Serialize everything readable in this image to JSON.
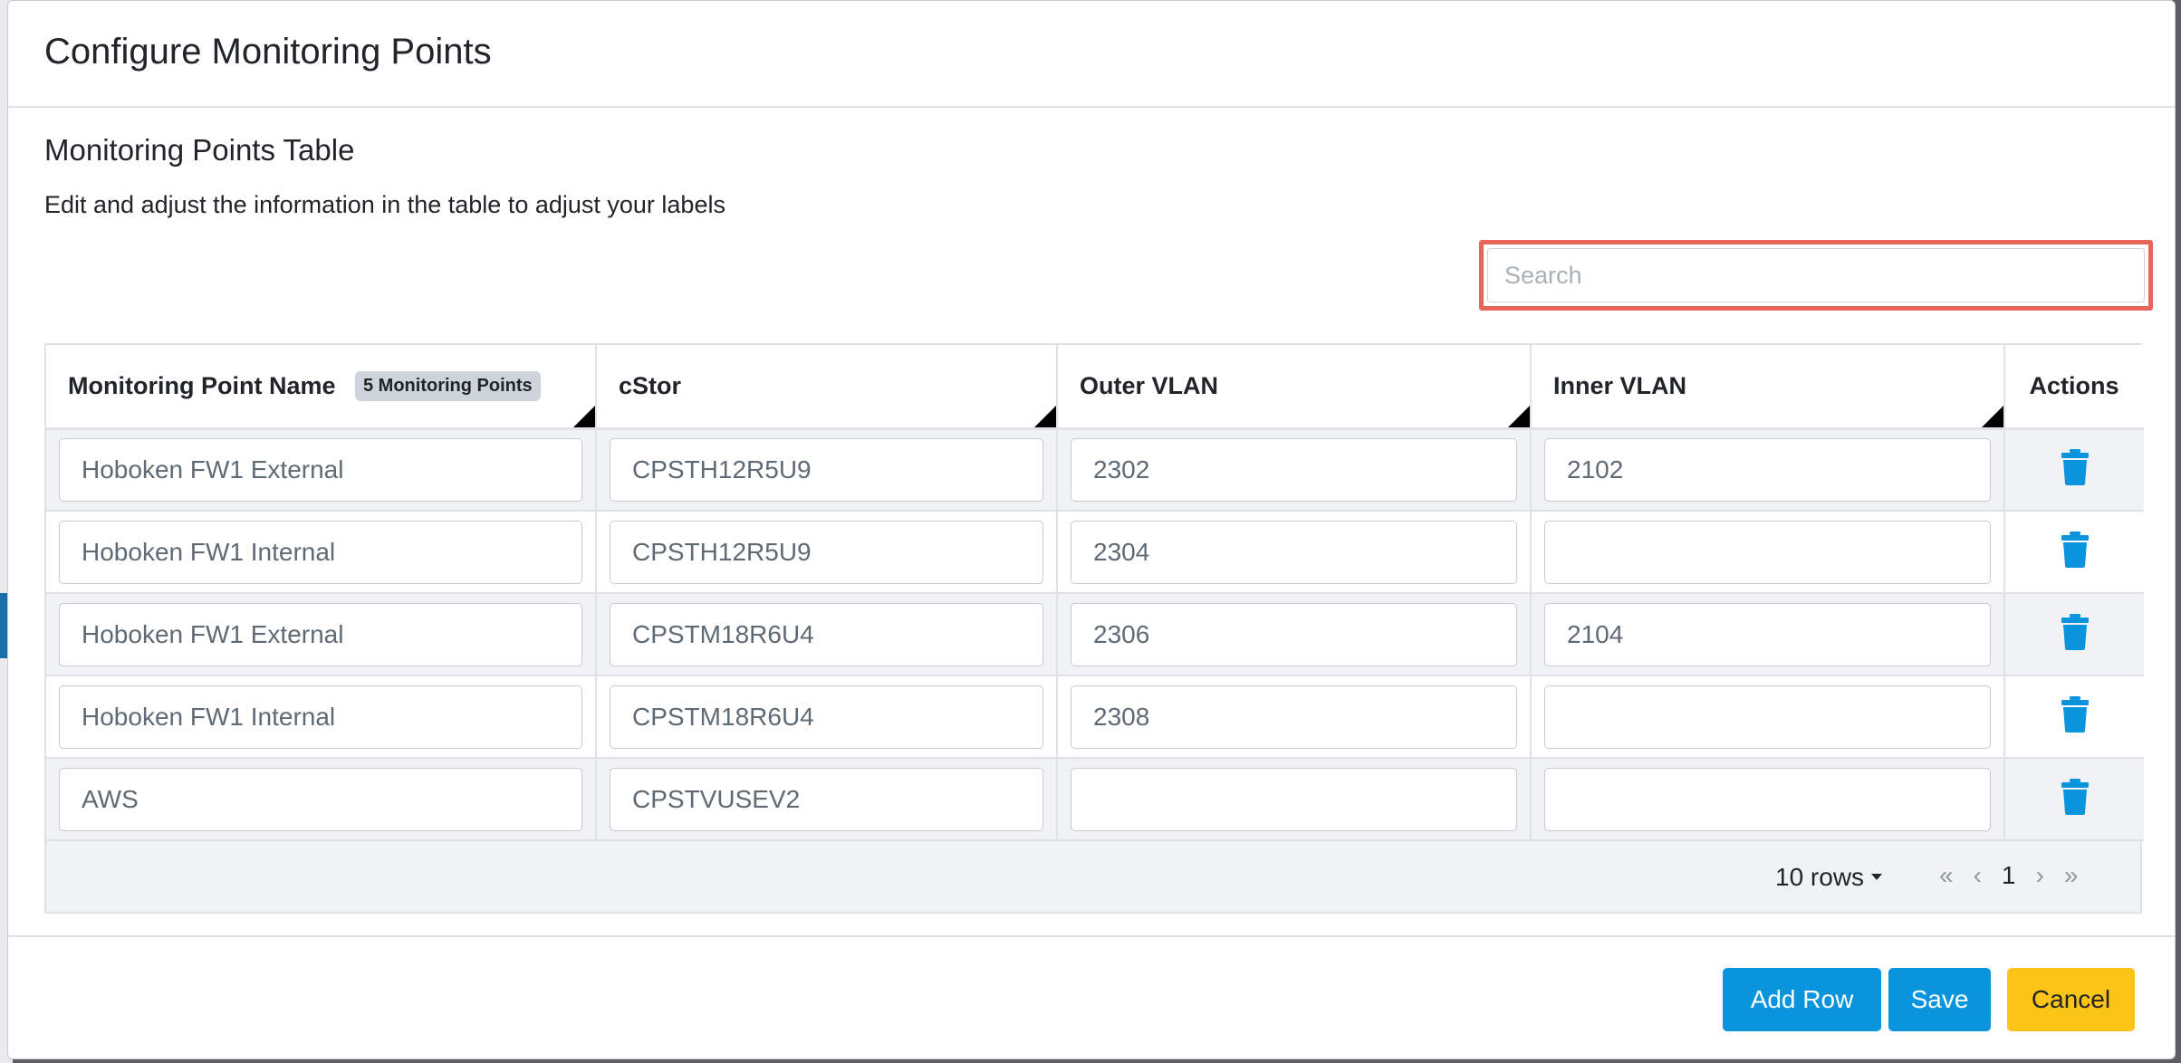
{
  "modal": {
    "title": "Configure Monitoring Points"
  },
  "section": {
    "title": "Monitoring Points Table",
    "description": "Edit and adjust the information in the table to adjust your labels"
  },
  "search": {
    "placeholder": "Search",
    "value": "",
    "highlight_color": "#e8655a"
  },
  "table": {
    "columns": [
      {
        "label": "Monitoring Point Name",
        "badge": "5 Monitoring Points"
      },
      {
        "label": "cStor"
      },
      {
        "label": "Outer VLAN"
      },
      {
        "label": "Inner VLAN"
      },
      {
        "label": "Actions"
      }
    ],
    "rows": [
      {
        "name": "Hoboken FW1 External",
        "cstor": "CPSTH12R5U9",
        "outer_vlan": "2302",
        "inner_vlan": "2102"
      },
      {
        "name": "Hoboken FW1 Internal",
        "cstor": "CPSTH12R5U9",
        "outer_vlan": "2304",
        "inner_vlan": ""
      },
      {
        "name": "Hoboken FW1 External",
        "cstor": "CPSTM18R6U4",
        "outer_vlan": "2306",
        "inner_vlan": "2104"
      },
      {
        "name": "Hoboken FW1 Internal",
        "cstor": "CPSTM18R6U4",
        "outer_vlan": "2308",
        "inner_vlan": ""
      },
      {
        "name": "AWS",
        "cstor": "CPSTVUSEV2",
        "outer_vlan": "",
        "inner_vlan": ""
      }
    ],
    "row_action_icon": "trash-icon",
    "action_icon_color": "#0a94dd"
  },
  "pagination": {
    "rows_per_page": "10 rows",
    "first": "«",
    "prev": "‹",
    "current_page": "1",
    "next": "›",
    "last": "»"
  },
  "footer": {
    "add_row_label": "Add Row",
    "save_label": "Save",
    "cancel_label": "Cancel",
    "primary_color": "#0a94dd",
    "cancel_color": "#fcc417"
  }
}
